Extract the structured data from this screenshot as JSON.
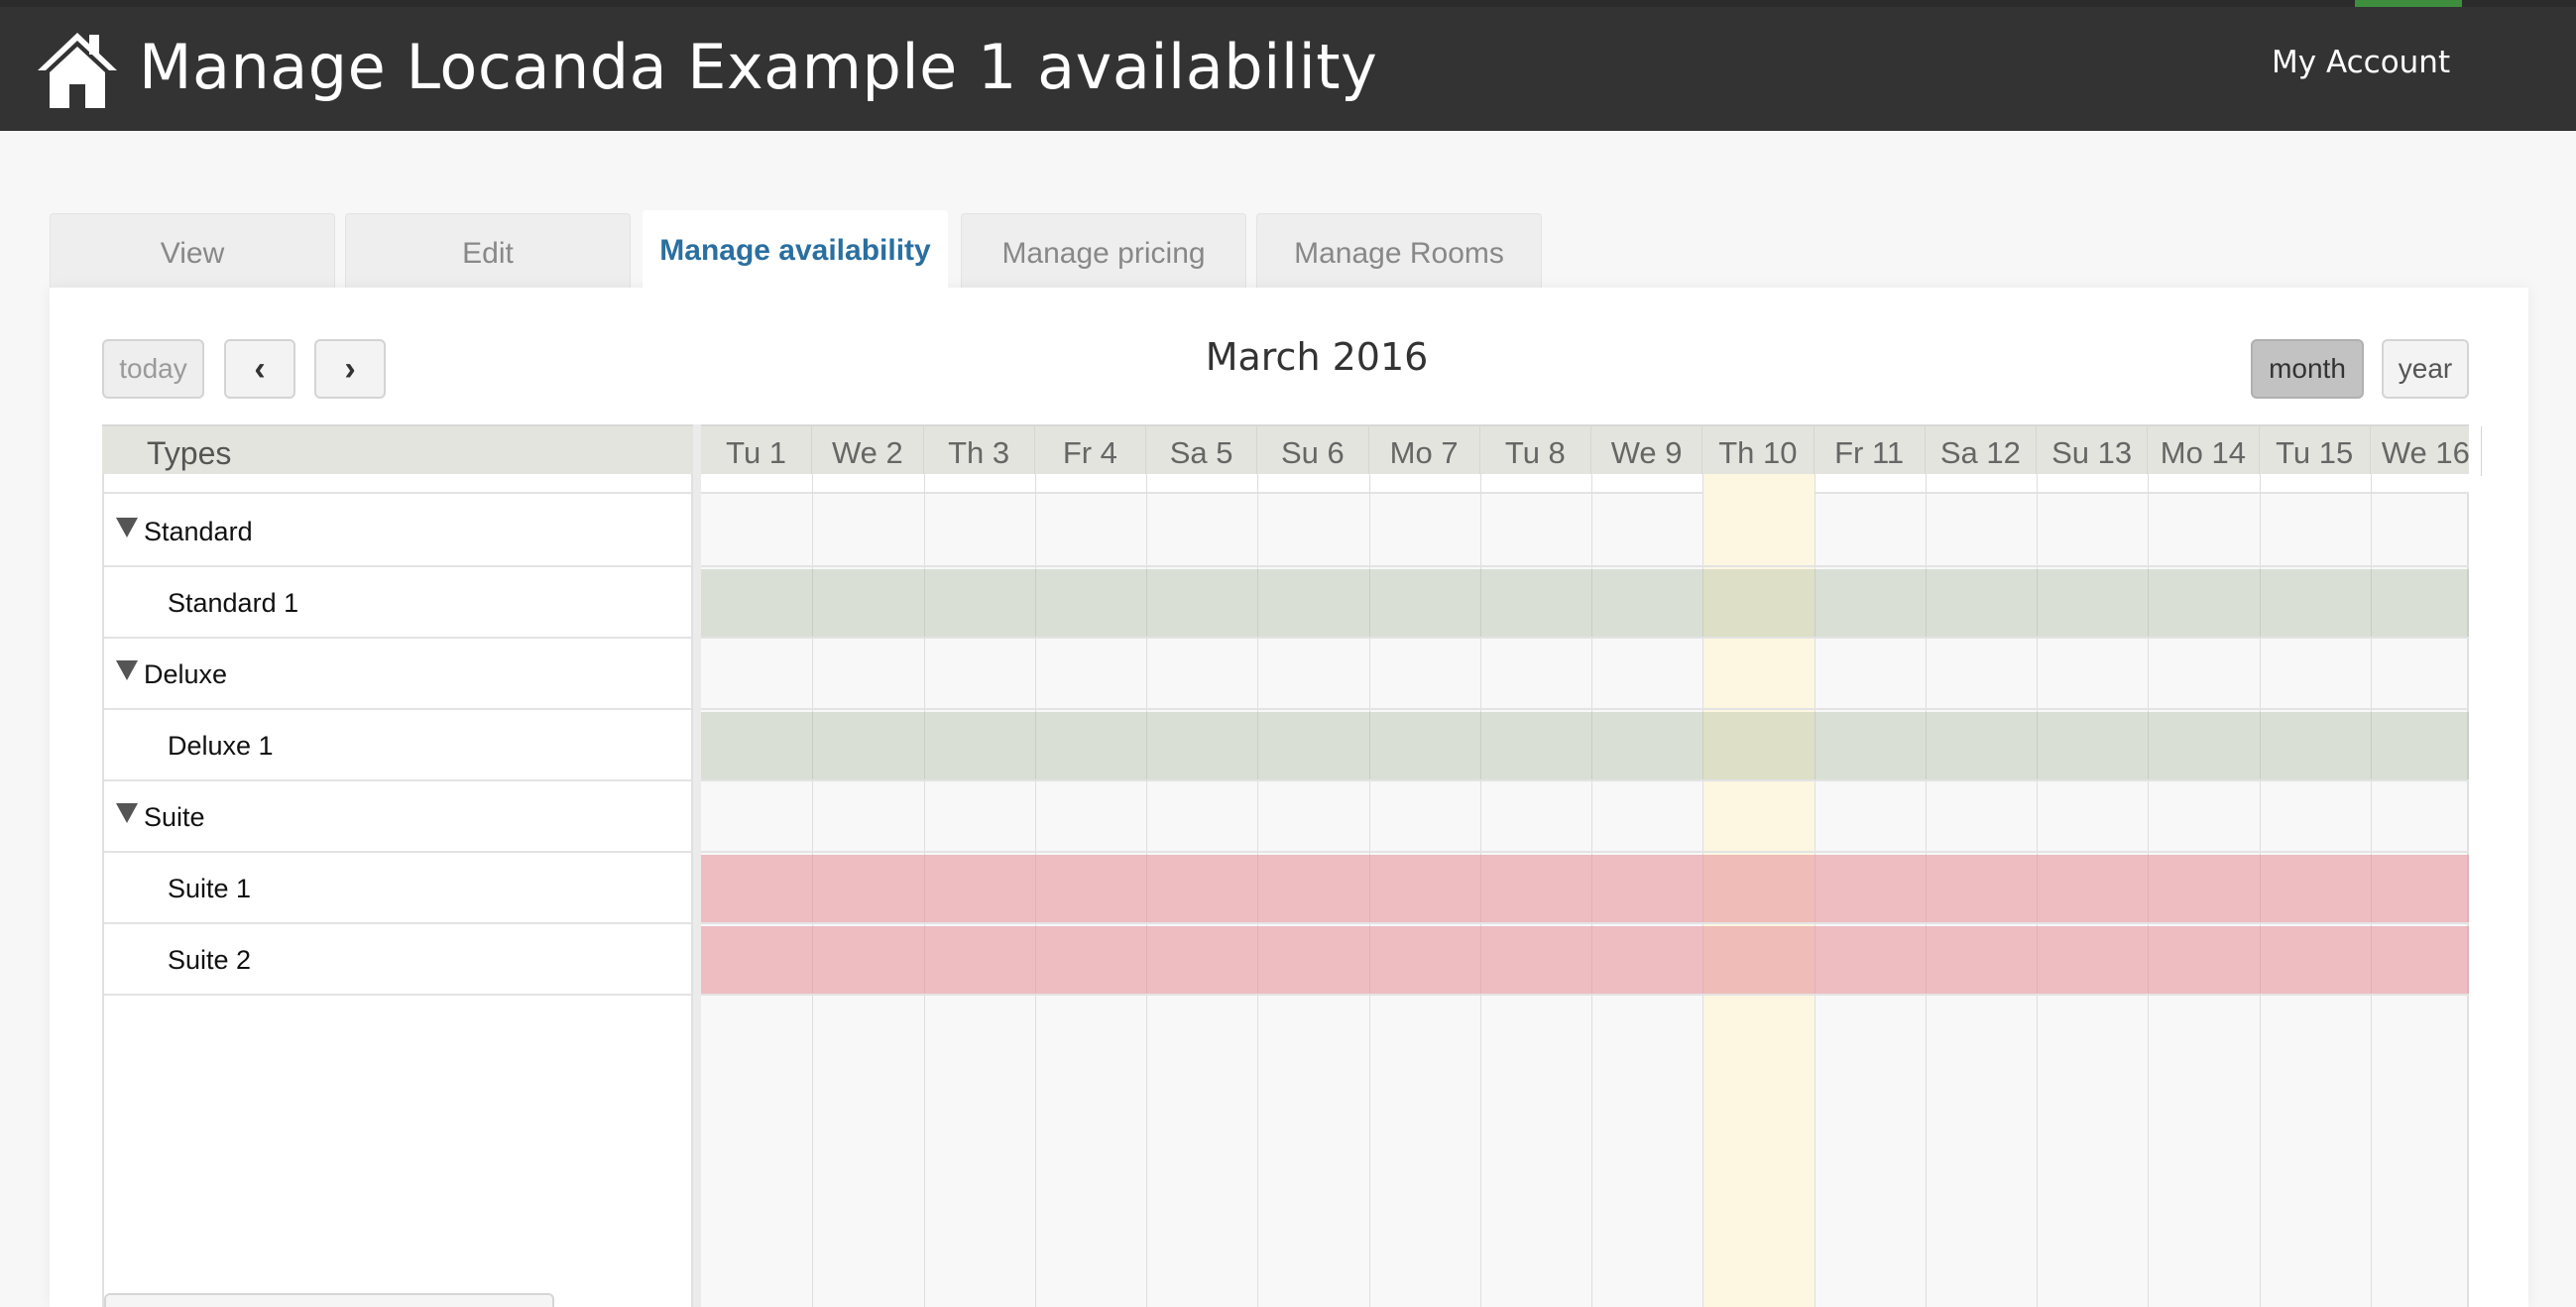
{
  "header": {
    "title": "Manage Locanda Example 1 availability",
    "home_icon": "home-icon",
    "account_label": "My Account"
  },
  "tabs": [
    {
      "label": "View",
      "active": false
    },
    {
      "label": "Edit",
      "active": false
    },
    {
      "label": "Manage availability",
      "active": true
    },
    {
      "label": "Manage pricing",
      "active": false
    },
    {
      "label": "Manage Rooms",
      "active": false
    }
  ],
  "toolbar": {
    "today_label": "today",
    "prev_icon": "chevron-left-icon",
    "prev_glyph": "‹",
    "next_icon": "chevron-right-icon",
    "next_glyph": "›",
    "month_label": "March 2016",
    "view_month_label": "month",
    "view_year_label": "year",
    "active_view": "month"
  },
  "types_header": "Types",
  "days": [
    "Tu 1",
    "We 2",
    "Th 3",
    "Fr 4",
    "Sa 5",
    "Su 6",
    "Mo 7",
    "Tu 8",
    "We 9",
    "Th 10",
    "Fr 11",
    "Sa 12",
    "Su 13",
    "Mo 14",
    "Tu 15",
    "We 16"
  ],
  "today_day": "Th 10",
  "rows": [
    {
      "kind": "group",
      "label": "Standard",
      "status": "none"
    },
    {
      "kind": "room",
      "label": "Standard 1",
      "status": "available"
    },
    {
      "kind": "group",
      "label": "Deluxe",
      "status": "none"
    },
    {
      "kind": "room",
      "label": "Deluxe 1",
      "status": "available"
    },
    {
      "kind": "group",
      "label": "Suite",
      "status": "none"
    },
    {
      "kind": "room",
      "label": "Suite 1",
      "status": "unavailable"
    },
    {
      "kind": "room",
      "label": "Suite 2",
      "status": "unavailable"
    }
  ],
  "colors": {
    "header_bg": "#333333",
    "active_tab_text": "#2a6fa0",
    "available": "#d8ddd2",
    "unavailable": "#ecb9bc",
    "today": "#fdf7e1"
  }
}
